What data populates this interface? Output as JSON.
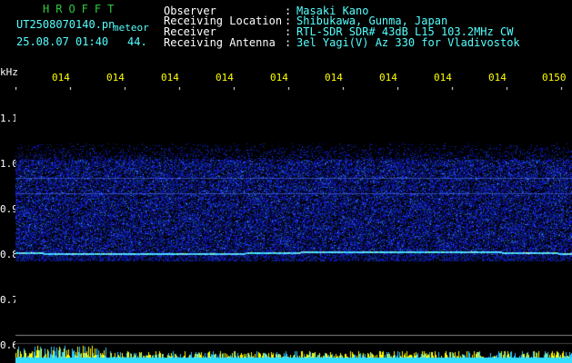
{
  "brand": "HROFFT",
  "filename": "UT2508070140.pn",
  "meteor_label": "meteor",
  "datetime": "25.08.07 01:40",
  "count": "44.",
  "info": [
    {
      "label": "Observer",
      "sep": ":",
      "value": "Masaki Kano"
    },
    {
      "label": "Receiving Location",
      "sep": ":",
      "value": "Shibukawa, Gunma, Japan"
    },
    {
      "label": "Receiver",
      "sep": ":",
      "value": "RTL-SDR SDR# 43dB L15 103.2MHz CW"
    },
    {
      "label": "Receiving Antenna",
      "sep": ":",
      "value": "3el Yagi(V) Az 330 for Vladivostok"
    }
  ],
  "y_axis": {
    "unit": "kHz",
    "ticks": [
      "1.1",
      "1.0",
      "0.9",
      "0.8",
      "0.7",
      "0.6"
    ]
  },
  "x_axis": {
    "ticks": [
      "014",
      "014",
      "014",
      "014",
      "014",
      "014",
      "014",
      "014",
      "014",
      "0150"
    ]
  },
  "colors": {
    "label": "#ffffff",
    "value": "#55ffff",
    "brand": "#2ecc40",
    "tick": "#ffff00",
    "signal": "#66ffff",
    "noise": "#1a2fb0"
  }
}
